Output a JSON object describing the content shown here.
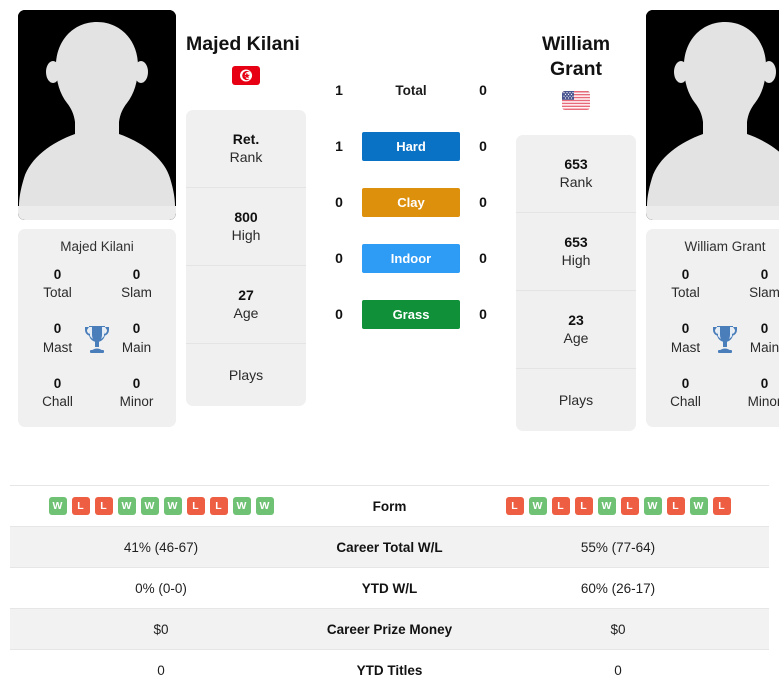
{
  "players": {
    "left": {
      "name": "Majed Kilani",
      "avatar_caption": "Majed Kilani",
      "flag": "tunisia-flag",
      "rank": "Ret.",
      "rank_label": "Rank",
      "high": "800",
      "high_label": "High",
      "age": "27",
      "age_label": "Age",
      "plays_label": "Plays",
      "plays_value": "",
      "titles": [
        {
          "num": "0",
          "label": "Total"
        },
        {
          "num": "0",
          "label": "Slam"
        },
        {
          "num": "0",
          "label": "Mast"
        },
        {
          "num": "0",
          "label": "Main"
        },
        {
          "num": "0",
          "label": "Chall"
        },
        {
          "num": "0",
          "label": "Minor"
        }
      ]
    },
    "right": {
      "name": "William Grant",
      "avatar_caption": "William Grant",
      "flag": "usa-flag",
      "rank": "653",
      "rank_label": "Rank",
      "high": "653",
      "high_label": "High",
      "age": "23",
      "age_label": "Age",
      "plays_label": "Plays",
      "plays_value": "",
      "titles": [
        {
          "num": "0",
          "label": "Total"
        },
        {
          "num": "0",
          "label": "Slam"
        },
        {
          "num": "0",
          "label": "Mast"
        },
        {
          "num": "0",
          "label": "Main"
        },
        {
          "num": "0",
          "label": "Chall"
        },
        {
          "num": "0",
          "label": "Minor"
        }
      ]
    }
  },
  "surfaces": [
    {
      "label": "Total",
      "left": "1",
      "right": "0",
      "color": "transparent",
      "plain": true
    },
    {
      "label": "Hard",
      "left": "1",
      "right": "0",
      "color": "#0a72c4",
      "plain": false
    },
    {
      "label": "Clay",
      "left": "0",
      "right": "0",
      "color": "#dd900c",
      "plain": false
    },
    {
      "label": "Indoor",
      "left": "0",
      "right": "0",
      "color": "#2e9bf5",
      "plain": false
    },
    {
      "label": "Grass",
      "left": "0",
      "right": "0",
      "color": "#109139",
      "plain": false
    }
  ],
  "comparison_rows": [
    {
      "label": "Form",
      "type": "form",
      "left_form": [
        "W",
        "L",
        "L",
        "W",
        "W",
        "W",
        "L",
        "L",
        "W",
        "W"
      ],
      "right_form": [
        "L",
        "W",
        "L",
        "L",
        "W",
        "L",
        "W",
        "L",
        "W",
        "L"
      ],
      "shaded": false
    },
    {
      "label": "Career Total W/L",
      "type": "text",
      "left": "41% (46-67)",
      "right": "55% (77-64)",
      "shaded": true
    },
    {
      "label": "YTD W/L",
      "type": "text",
      "left": "0% (0-0)",
      "right": "60% (26-17)",
      "shaded": false
    },
    {
      "label": "Career Prize Money",
      "type": "text",
      "left": "$0",
      "right": "$0",
      "shaded": true
    },
    {
      "label": "YTD Titles",
      "type": "text",
      "left": "0",
      "right": "0",
      "shaded": false
    }
  ],
  "colors": {
    "hard": "#0a72c4",
    "clay": "#dd900c",
    "indoor": "#2e9bf5",
    "grass": "#109139",
    "win": "#6fc174",
    "loss": "#ee5e43",
    "trophy": "#4a7ebb"
  }
}
